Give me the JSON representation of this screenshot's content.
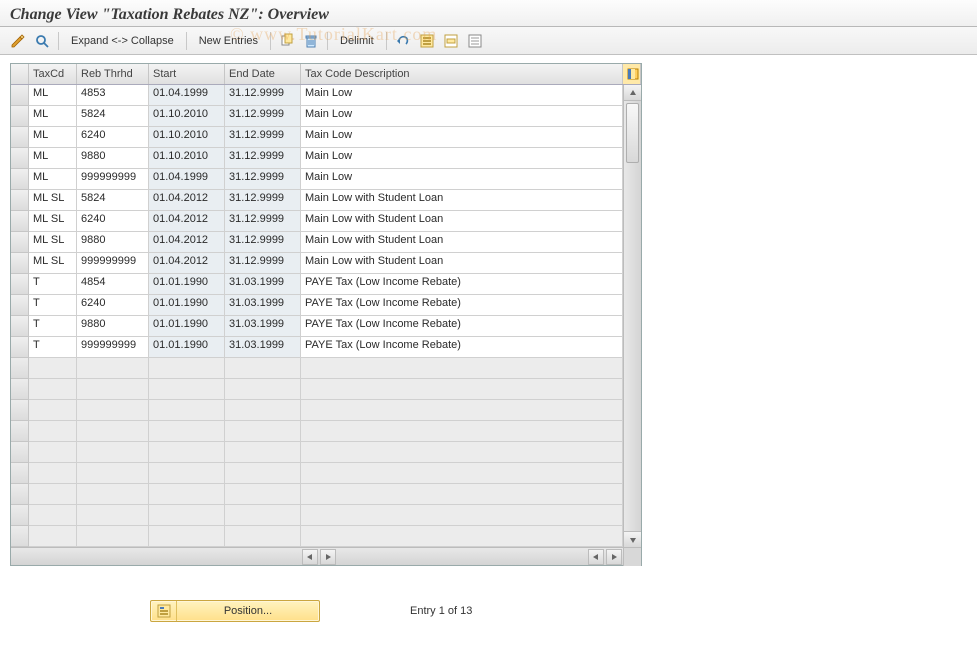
{
  "title": "Change View \"Taxation Rebates NZ\": Overview",
  "watermark": "© www.TutorialKart.com",
  "toolbar": {
    "expand_collapse": "Expand <-> Collapse",
    "new_entries": "New Entries",
    "delimit": "Delimit"
  },
  "columns": {
    "taxcd": "TaxCd",
    "reb": "Reb Thrhd",
    "start": "Start",
    "end": "End Date",
    "desc": "Tax Code Description"
  },
  "rows": [
    {
      "taxcd": "ML",
      "reb": "4853",
      "start": "01.04.1999",
      "end": "31.12.9999",
      "desc": "Main Low"
    },
    {
      "taxcd": "ML",
      "reb": "5824",
      "start": "01.10.2010",
      "end": "31.12.9999",
      "desc": "Main Low"
    },
    {
      "taxcd": "ML",
      "reb": "6240",
      "start": "01.10.2010",
      "end": "31.12.9999",
      "desc": "Main Low"
    },
    {
      "taxcd": "ML",
      "reb": "9880",
      "start": "01.10.2010",
      "end": "31.12.9999",
      "desc": "Main Low"
    },
    {
      "taxcd": "ML",
      "reb": "999999999",
      "start": "01.04.1999",
      "end": "31.12.9999",
      "desc": "Main Low"
    },
    {
      "taxcd": "ML SL",
      "reb": "5824",
      "start": "01.04.2012",
      "end": "31.12.9999",
      "desc": "Main Low with Student Loan"
    },
    {
      "taxcd": "ML SL",
      "reb": "6240",
      "start": "01.04.2012",
      "end": "31.12.9999",
      "desc": "Main Low with Student Loan"
    },
    {
      "taxcd": "ML SL",
      "reb": "9880",
      "start": "01.04.2012",
      "end": "31.12.9999",
      "desc": "Main Low with Student Loan"
    },
    {
      "taxcd": "ML SL",
      "reb": "999999999",
      "start": "01.04.2012",
      "end": "31.12.9999",
      "desc": "Main Low with Student Loan"
    },
    {
      "taxcd": "T",
      "reb": "4854",
      "start": "01.01.1990",
      "end": "31.03.1999",
      "desc": "PAYE Tax (Low Income Rebate)"
    },
    {
      "taxcd": "T",
      "reb": "6240",
      "start": "01.01.1990",
      "end": "31.03.1999",
      "desc": "PAYE Tax (Low Income Rebate)"
    },
    {
      "taxcd": "T",
      "reb": "9880",
      "start": "01.01.1990",
      "end": "31.03.1999",
      "desc": "PAYE Tax (Low Income Rebate)"
    },
    {
      "taxcd": "T",
      "reb": "999999999",
      "start": "01.01.1990",
      "end": "31.03.1999",
      "desc": "PAYE Tax (Low Income Rebate)"
    }
  ],
  "empty_row_count": 9,
  "footer": {
    "position_label": "Position...",
    "entry_text": "Entry 1 of 13"
  }
}
